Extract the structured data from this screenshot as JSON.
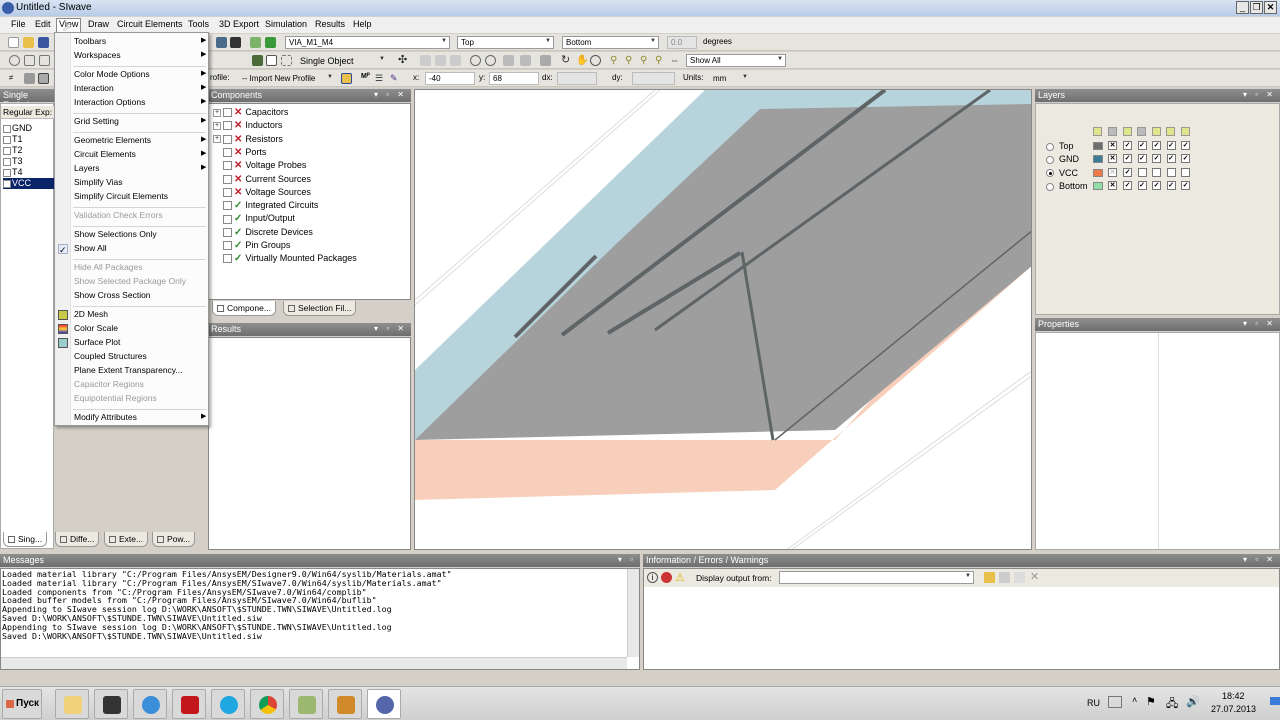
{
  "window": {
    "title": "Untitled - SIwave",
    "controls": [
      "minimize",
      "restore",
      "close"
    ]
  },
  "menubar": [
    "File",
    "Edit",
    "View",
    "Draw",
    "Circuit Elements",
    "Tools",
    "3D Export",
    "Simulation",
    "Results",
    "Help"
  ],
  "toolbar": {
    "via_combo": "VIA_M1_M4",
    "start_layer": "Top",
    "end_layer": "Bottom",
    "angle_value": "0.0",
    "angle_unit": "degrees",
    "select_mode": "Single Object",
    "show_filter": "Show All",
    "profile_label": "rofile:",
    "profile_combo": "-- Import New Profile",
    "x_label": "x:",
    "x_value": "-40",
    "y_label": "y:",
    "y_value": "68",
    "dx_label": "dx:",
    "dx_value": "",
    "dy_label": "dy:",
    "dy_value": "",
    "units_label": "Units:",
    "units_value": "mm"
  },
  "view_menu": {
    "items": [
      {
        "label": "Toolbars",
        "submenu": true,
        "disabled": false
      },
      {
        "label": "Workspaces",
        "submenu": true,
        "disabled": false
      },
      {
        "label": "Color Mode Options",
        "submenu": true,
        "disabled": false
      },
      {
        "label": "Interaction",
        "submenu": true,
        "disabled": false
      },
      {
        "label": "Interaction Options",
        "submenu": true,
        "disabled": false
      },
      {
        "label": "Grid Setting",
        "submenu": true,
        "disabled": false
      },
      {
        "label": "Geometric Elements",
        "submenu": true,
        "disabled": false
      },
      {
        "label": "Circuit Elements",
        "submenu": true,
        "disabled": false
      },
      {
        "label": "Layers",
        "submenu": true,
        "disabled": false
      },
      {
        "label": "Simplify Vias",
        "submenu": false,
        "disabled": false
      },
      {
        "label": "Simplify Circuit Elements",
        "submenu": false,
        "disabled": false
      },
      {
        "label": "Validation Check Errors",
        "submenu": false,
        "disabled": true
      },
      {
        "label": "Show Selections Only",
        "submenu": false,
        "disabled": false
      },
      {
        "label": "Show All",
        "submenu": false,
        "disabled": false,
        "checked": true
      },
      {
        "label": "Hide All Packages",
        "submenu": false,
        "disabled": true
      },
      {
        "label": "Show Selected Package Only",
        "submenu": false,
        "disabled": true
      },
      {
        "label": "Show Cross Section",
        "submenu": false,
        "disabled": false
      },
      {
        "label": "2D Mesh",
        "submenu": false,
        "disabled": false,
        "icon": "mesh-icon"
      },
      {
        "label": "Color Scale",
        "submenu": false,
        "disabled": false,
        "icon": "color-scale-icon"
      },
      {
        "label": "Surface Plot",
        "submenu": false,
        "disabled": false,
        "icon": "surface-plot-icon"
      },
      {
        "label": "Coupled Structures",
        "submenu": false,
        "disabled": false
      },
      {
        "label": "Plane Extent Transparency...",
        "submenu": false,
        "disabled": false
      },
      {
        "label": "Capacitor Regions",
        "submenu": false,
        "disabled": true
      },
      {
        "label": "Equipotential Regions",
        "submenu": false,
        "disabled": true
      },
      {
        "label": "Modify Attributes",
        "submenu": true,
        "disabled": false
      }
    ]
  },
  "nets_panel": {
    "title": "Single Ended",
    "filter_label": "Regular Exp:",
    "nets": [
      "GND",
      "T1",
      "T2",
      "T3",
      "T4",
      "VCC"
    ],
    "selected": "VCC",
    "tabs": [
      "Sing...",
      "Diffe...",
      "Exte...",
      "Pow..."
    ]
  },
  "components_panel": {
    "title": "Components",
    "items": [
      {
        "label": "Capacitors",
        "expandable": true,
        "status": "x"
      },
      {
        "label": "Inductors",
        "expandable": true,
        "status": "x"
      },
      {
        "label": "Resistors",
        "expandable": true,
        "status": "x"
      },
      {
        "label": "Ports",
        "expandable": false,
        "status": "x"
      },
      {
        "label": "Voltage Probes",
        "expandable": false,
        "status": "x"
      },
      {
        "label": "Current Sources",
        "expandable": false,
        "status": "x"
      },
      {
        "label": "Voltage Sources",
        "expandable": false,
        "status": "x"
      },
      {
        "label": "Integrated Circuits",
        "expandable": false,
        "status": "check"
      },
      {
        "label": "Input/Output",
        "expandable": false,
        "status": "check"
      },
      {
        "label": "Discrete Devices",
        "expandable": false,
        "status": "check"
      },
      {
        "label": "Pin Groups",
        "expandable": false,
        "status": "check"
      },
      {
        "label": "Virtually Mounted Packages",
        "expandable": false,
        "status": "check"
      }
    ],
    "tabs": [
      "Compone...",
      "Selection Fil..."
    ]
  },
  "results_panel": {
    "title": "Results"
  },
  "layers_panel": {
    "title": "Layers",
    "layers": [
      {
        "name": "Top",
        "color": "#6e6e6e",
        "active": false,
        "visibility": [
          true,
          true,
          true,
          true,
          true
        ]
      },
      {
        "name": "GND",
        "color": "#3a7d94",
        "active": false,
        "visibility": [
          true,
          true,
          true,
          true,
          true
        ]
      },
      {
        "name": "VCC",
        "color": "#f07a4a",
        "active": true,
        "visibility": [
          true,
          false,
          false,
          false,
          false
        ]
      },
      {
        "name": "Bottom",
        "color": "#8ee0a8",
        "active": false,
        "visibility": [
          true,
          true,
          true,
          true,
          true
        ]
      }
    ]
  },
  "properties_panel": {
    "title": "Properties"
  },
  "messages_panel": {
    "title": "Messages",
    "lines": [
      "Loaded material library \"C:/Program Files/AnsysEM/Designer9.0/Win64/syslib/Materials.amat\"",
      "Loaded material library \"C:/Program Files/AnsysEM/SIwave7.0/Win64/syslib/Materials.amat\"",
      "Loaded components from \"C:/Program Files/AnsysEM/SIwave7.0/Win64/complib\"",
      "Loaded buffer models from \"C:/Program Files/AnsysEM/SIwave7.0/Win64/buflib\"",
      "Appending to SIwave session log D:\\WORK\\ANSOFT\\$STUNDE.TWN\\SIWAVE\\Untitled.log",
      "Saved D:\\WORK\\ANSOFT\\$STUNDE.TWN\\SIWAVE\\Untitled.siw",
      "Appending to SIwave session log D:\\WORK\\ANSOFT\\$STUNDE.TWN\\SIWAVE\\Untitled.log",
      "Saved D:\\WORK\\ANSOFT\\$STUNDE.TWN\\SIWAVE\\Untitled.siw"
    ]
  },
  "info_panel": {
    "title": "Information / Errors / Warnings",
    "display_label": "Display output from:",
    "display_value": ""
  },
  "viewport": {
    "colors": {
      "gnd_plane": "#b7d3dc",
      "top_plane": "#9e9e9e",
      "vcc_plane": "#f8cfbb",
      "traces": "#5f6466"
    }
  },
  "taskbar": {
    "start_label": "Пуск",
    "apps": [
      "explorer",
      "media-player",
      "navigator",
      "acrobat",
      "skype",
      "chrome",
      "notes",
      "files",
      "siwave"
    ],
    "language": "RU",
    "time": "18:42",
    "date": "27.07.2013"
  }
}
